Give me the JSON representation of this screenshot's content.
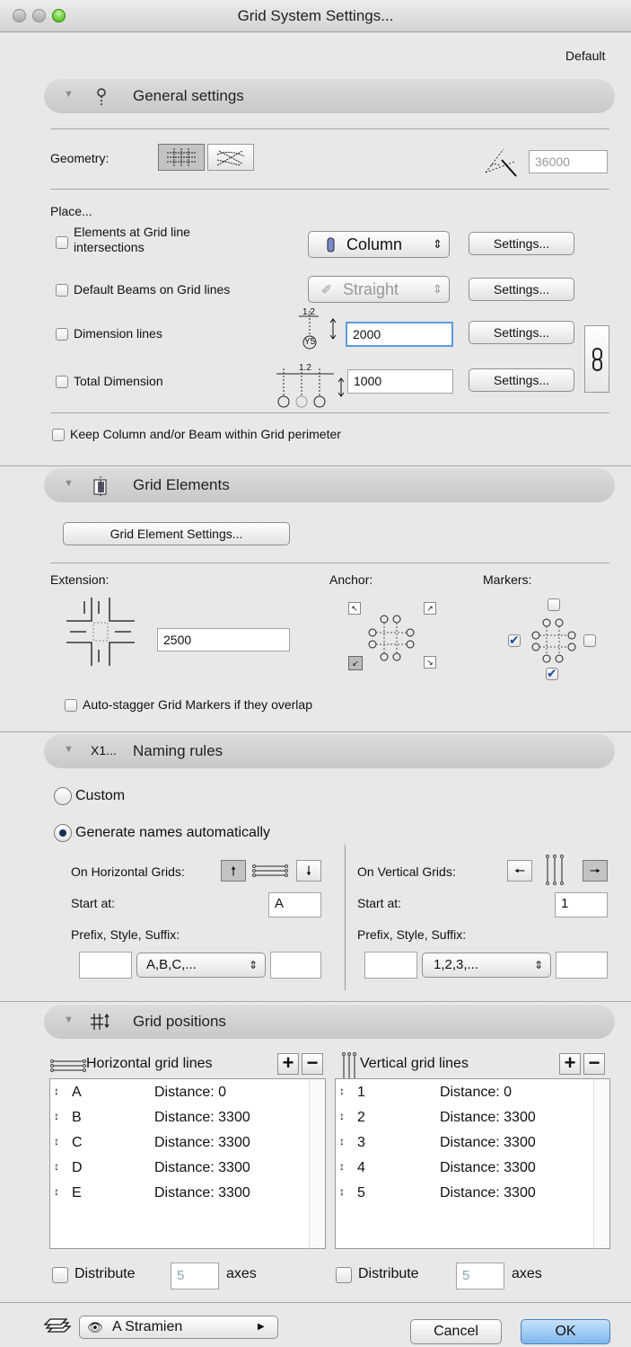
{
  "window": {
    "title": "Grid System Settings...",
    "default_label": "Default"
  },
  "general": {
    "header": "General settings",
    "geometry_label": "Geometry:",
    "angle_value": "36000",
    "place_label": "Place...",
    "elements_label_1": "Elements at Grid line",
    "elements_label_2": "intersections",
    "column_popup": "Column",
    "beams_label": "Default Beams on Grid lines",
    "straight_popup": "Straight",
    "dimension_label": "Dimension lines",
    "dimension_value": "2000",
    "total_label": "Total Dimension",
    "total_value": "1000",
    "settings_label": "Settings...",
    "keep_label": "Keep Column and/or Beam within Grid perimeter",
    "dim_marker": "1.2",
    "marker_text": "Y5"
  },
  "grid_elements": {
    "header": "Grid Elements",
    "settings_button": "Grid Element Settings...",
    "extension_label": "Extension:",
    "extension_value": "2500",
    "anchor_label": "Anchor:",
    "markers_label": "Markers:",
    "autostagger_label": "Auto-stagger Grid Markers if they overlap"
  },
  "naming": {
    "header": "Naming rules",
    "header_icon_text": "X1...",
    "custom_label": "Custom",
    "auto_label": "Generate names automatically",
    "horizontal": {
      "label": "On Horizontal Grids:",
      "start_label": "Start at:",
      "start_value": "A",
      "prefix_label": "Prefix, Style, Suffix:",
      "style": "A,B,C,..."
    },
    "vertical": {
      "label": "On Vertical Grids:",
      "start_label": "Start at:",
      "start_value": "1",
      "prefix_label": "Prefix, Style, Suffix:",
      "style": "1,2,3,..."
    }
  },
  "positions": {
    "header": "Grid positions",
    "horizontal_title": "Horizontal grid lines",
    "vertical_title": "Vertical grid lines",
    "horizontal_rows": [
      {
        "name": "A",
        "distance": "Distance: 0"
      },
      {
        "name": "B",
        "distance": "Distance: 3300"
      },
      {
        "name": "C",
        "distance": "Distance: 3300"
      },
      {
        "name": "D",
        "distance": "Distance: 3300"
      },
      {
        "name": "E",
        "distance": "Distance: 3300"
      }
    ],
    "vertical_rows": [
      {
        "name": "1",
        "distance": "Distance: 0"
      },
      {
        "name": "2",
        "distance": "Distance: 3300"
      },
      {
        "name": "3",
        "distance": "Distance: 3300"
      },
      {
        "name": "4",
        "distance": "Distance: 3300"
      },
      {
        "name": "5",
        "distance": "Distance: 3300"
      }
    ],
    "distribute_label": "Distribute",
    "axes_label": "axes",
    "distribute_h_value": "5",
    "distribute_v_value": "5"
  },
  "footer": {
    "layer": "A Stramien",
    "cancel": "Cancel",
    "ok": "OK"
  },
  "colors": {
    "accent": "#1d4a9e",
    "ok_button": "#8fc3f2",
    "focus_ring": "#5a9be0"
  }
}
